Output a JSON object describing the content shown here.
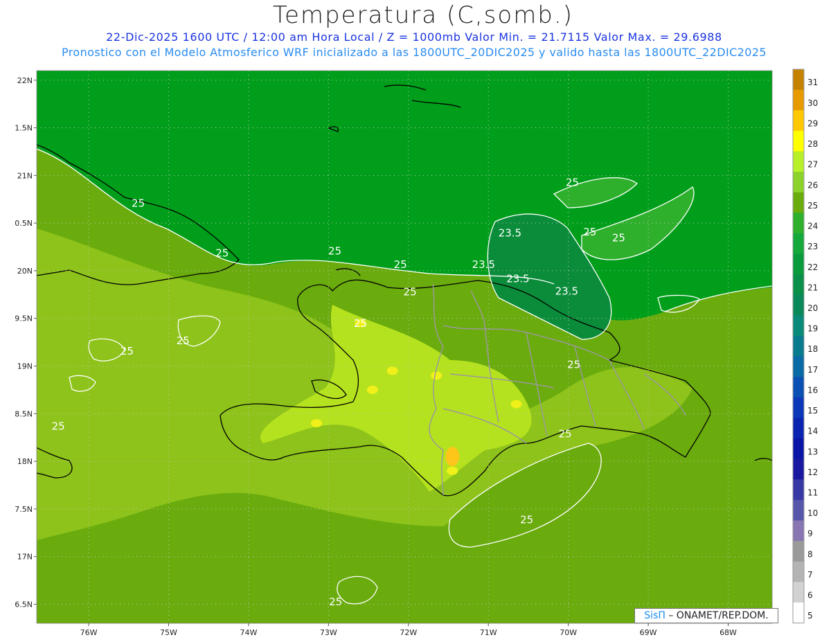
{
  "header": {
    "title": "Temperatura (C,somb.)",
    "subtitle1": "22-Dic-2025 1600 UTC / 12:00 am Hora Local / Z = 1000mb   Valor Min. = 21.7115  Valor Max. = 29.6988",
    "subtitle2": "Pronostico con el Modelo Atmosferico WRF inicializado a las 1800UTC_20DIC2025 y valido hasta las  1800UTC_22DIC2025"
  },
  "map": {
    "lon_range": [
      -76.65,
      -67.45
    ],
    "lat_range": [
      16.3,
      22.1
    ],
    "lat_ticks": [
      {
        "value": 22.0,
        "label": "22N"
      },
      {
        "value": 21.5,
        "label": "1.5N"
      },
      {
        "value": 21.0,
        "label": "21N"
      },
      {
        "value": 20.5,
        "label": "0.5N"
      },
      {
        "value": 20.0,
        "label": "20N"
      },
      {
        "value": 19.5,
        "label": "9.5N"
      },
      {
        "value": 19.0,
        "label": "19N"
      },
      {
        "value": 18.5,
        "label": "8.5N"
      },
      {
        "value": 18.0,
        "label": "18N"
      },
      {
        "value": 17.5,
        "label": "7.5N"
      },
      {
        "value": 17.0,
        "label": "17N"
      },
      {
        "value": 16.5,
        "label": "6.5N"
      }
    ],
    "lon_ticks": [
      {
        "value": -76,
        "label": "76W"
      },
      {
        "value": -75,
        "label": "75W"
      },
      {
        "value": -74,
        "label": "74W"
      },
      {
        "value": -73,
        "label": "73W"
      },
      {
        "value": -72,
        "label": "72W"
      },
      {
        "value": -71,
        "label": "71W"
      },
      {
        "value": -70,
        "label": "70W"
      },
      {
        "value": -69,
        "label": "69W"
      },
      {
        "value": -68,
        "label": "68W"
      }
    ],
    "field_colors": {
      "ocean": "#009e1a",
      "band_24": "#2fb02c",
      "band_25": "#6aab0e",
      "band_26": "#8dc31a",
      "band_27": "#b5e21e",
      "band_28": "#f0f01a",
      "band_29": "#ffc61a",
      "band_23": "#0a8c3a",
      "coast": "#000000",
      "border": "#9a9a9a",
      "contour": "#ffffff"
    },
    "contour_labels": [
      {
        "text": "25",
        "lon": -75.38,
        "lat": 20.67
      },
      {
        "text": "25",
        "lon": -74.33,
        "lat": 20.15
      },
      {
        "text": "25",
        "lon": -72.92,
        "lat": 20.17
      },
      {
        "text": "25",
        "lon": -72.1,
        "lat": 20.03
      },
      {
        "text": "25",
        "lon": -71.98,
        "lat": 19.74
      },
      {
        "text": "25",
        "lon": -72.6,
        "lat": 19.41
      },
      {
        "text": "25",
        "lon": -75.52,
        "lat": 19.12
      },
      {
        "text": "25",
        "lon": -74.82,
        "lat": 19.23
      },
      {
        "text": "25",
        "lon": -76.38,
        "lat": 18.33
      },
      {
        "text": "25",
        "lon": -69.95,
        "lat": 20.89
      },
      {
        "text": "25",
        "lon": -69.73,
        "lat": 20.37
      },
      {
        "text": "25",
        "lon": -69.37,
        "lat": 20.31
      },
      {
        "text": "25",
        "lon": -69.93,
        "lat": 18.98
      },
      {
        "text": "25",
        "lon": -70.04,
        "lat": 18.25
      },
      {
        "text": "25",
        "lon": -70.52,
        "lat": 17.35
      },
      {
        "text": "25",
        "lon": -72.91,
        "lat": 16.49
      },
      {
        "text": "23.5",
        "lon": -70.73,
        "lat": 20.36
      },
      {
        "text": "23.5",
        "lon": -71.06,
        "lat": 20.03
      },
      {
        "text": "23.5",
        "lon": -70.63,
        "lat": 19.88
      },
      {
        "text": "23.5",
        "lon": -70.02,
        "lat": 19.75
      }
    ]
  },
  "colorbar": {
    "levels": [
      "31",
      "30",
      "29",
      "28",
      "27",
      "26",
      "25",
      "24",
      "23",
      "22",
      "21",
      "20",
      "19",
      "18",
      "17",
      "16",
      "15",
      "14",
      "13",
      "12",
      "11",
      "10",
      "9",
      "8",
      "7",
      "6",
      "5"
    ],
    "colors": [
      "#c48200",
      "#e79b00",
      "#ffc800",
      "#ffff00",
      "#b7ef28",
      "#8dd22a",
      "#6aab0e",
      "#2fb02c",
      "#15a83a",
      "#0a9c3c",
      "#0a9048",
      "#0a8a5a",
      "#0a8a78",
      "#0a7a8e",
      "#0a6aa6",
      "#0a50b4",
      "#0a38b8",
      "#0a24b0",
      "#0a14a6",
      "#1818a0",
      "#3838a6",
      "#5656aa",
      "#8876b2",
      "#9a9a9a",
      "#b4b4b4",
      "#d2d2d2",
      "#ffffff"
    ]
  },
  "credit": {
    "brand": "SisΠ",
    "text": " – ONAMET/REP.DOM."
  }
}
